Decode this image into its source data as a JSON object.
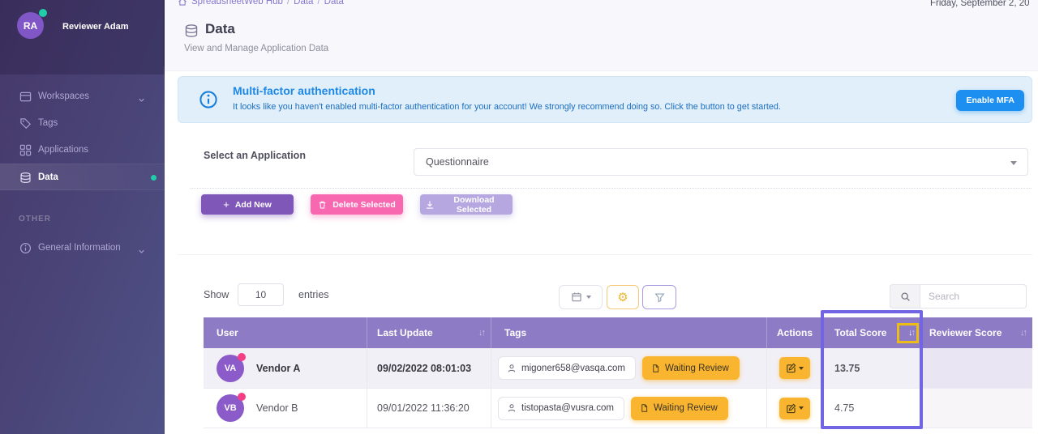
{
  "colors": {
    "sidebar_start": "#46386a",
    "sidebar_end": "#4f5287",
    "table_header_purple": "#8d7bc5",
    "button_purple": "#7e57b8",
    "button_pink": "#f868b0",
    "button_lavender": "#b6a7e0",
    "banner_title_blue": "#1e88e5",
    "enable_mfa_blue": "#1d8ff1",
    "amber": "#f9b52f",
    "teal_status": "#1fcdaa",
    "pink_dot": "#f43e85",
    "highlight_box_blue": "#7165e3",
    "highlight_box_yellow": "#edbc17"
  },
  "icons": {
    "gear": "⚙",
    "plus": "+",
    "sort_down": "↓",
    "sort_up": "↑"
  },
  "sidebar": {
    "user": {
      "initials": "RA",
      "name": "Reviewer Adam"
    },
    "items": [
      {
        "label": "Workspaces"
      },
      {
        "label": "Tags"
      },
      {
        "label": "Applications"
      },
      {
        "label": "Data"
      }
    ],
    "section_label": "OTHER",
    "general_info_label": "General Information"
  },
  "topbar": {
    "breadcrumb_home": "SpreadsheetWeb Hub",
    "breadcrumb_sep": "/",
    "breadcrumb_item1": "Data",
    "breadcrumb_item2": "Data",
    "date": "Friday, September 2, 20"
  },
  "page": {
    "title": "Data",
    "subtitle": "View and Manage Application Data"
  },
  "banner": {
    "title": "Multi-factor authentication",
    "message": "It looks like you haven't enabled multi-factor authentication for your account! We strongly recommend doing so. Click the button to get started.",
    "button": "Enable MFA"
  },
  "application": {
    "label": "Select an Application",
    "selected": "Questionnaire"
  },
  "toolbar": {
    "add": "Add New",
    "delete": "Delete Selected",
    "download": "Download Selected"
  },
  "controls": {
    "show": "Show",
    "entries_value": "10",
    "entries": "entries",
    "search_placeholder": "Search"
  },
  "table": {
    "columns": {
      "user": "User",
      "last_update": "Last Update",
      "tags": "Tags",
      "actions": "Actions",
      "total_score": "Total Score",
      "reviewer_score": "Reviewer Score"
    },
    "rows": [
      {
        "initials": "VA",
        "name": "Vendor A",
        "last_update": "09/02/2022 08:01:03",
        "email": "migoner658@vasqa.com",
        "status": "Waiting Review",
        "total_score": "13.75",
        "reviewer_score": ""
      },
      {
        "initials": "VB",
        "name": "Vendor B",
        "last_update": "09/01/2022 11:36:20",
        "email": "tistopasta@vusra.com",
        "status": "Waiting Review",
        "total_score": "4.75",
        "reviewer_score": ""
      }
    ]
  }
}
